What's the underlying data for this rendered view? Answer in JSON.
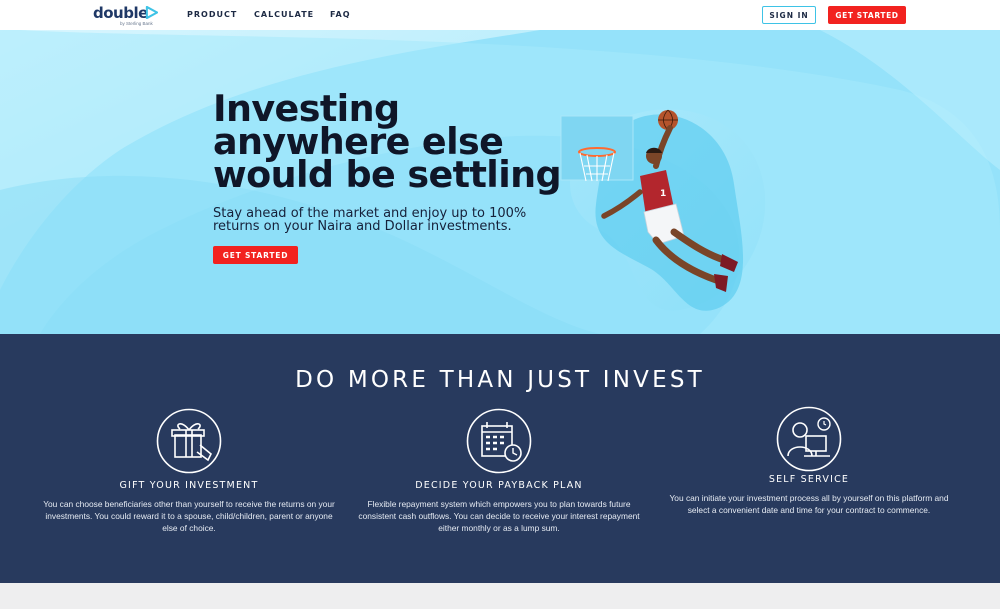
{
  "nav": {
    "logo_text": "double",
    "logo_subtext": "by Sterling Bank",
    "links": [
      "PRODUCT",
      "CALCULATE",
      "FAQ"
    ],
    "sign_in": "SIGN IN",
    "get_started": "GET STARTED"
  },
  "hero": {
    "title": "Investing anywhere else would be settling",
    "subtitle": "Stay ahead of the market and enjoy up to 100% returns on your Naira and Dollar investments.",
    "cta": "GET STARTED",
    "jersey_number": "1"
  },
  "features": {
    "title": "DO MORE THAN JUST INVEST",
    "items": [
      {
        "icon": "gift-icon",
        "heading": "GIFT YOUR INVESTMENT",
        "text": "You can choose beneficiaries other than yourself to receive the returns on your investments. You could reward it to a spouse, child/children, parent or anyone else of choice."
      },
      {
        "icon": "calendar-clock-icon",
        "heading": "DECIDE YOUR PAYBACK PLAN",
        "text": "Flexible repayment system which empowers you to plan towards future consistent cash outflows. You can decide to receive your interest repayment either monthly or as a lump sum."
      },
      {
        "icon": "self-service-icon",
        "heading": "SELF SERVICE",
        "text": "You can initiate your investment process all by yourself on this platform and select a convenient date and time for your contract to commence."
      }
    ]
  },
  "colors": {
    "brand_navy": "#283a5e",
    "accent_red": "#f2221f",
    "hero_blue": "#8ee0f9",
    "logo_cyan": "#3ec3e6"
  }
}
